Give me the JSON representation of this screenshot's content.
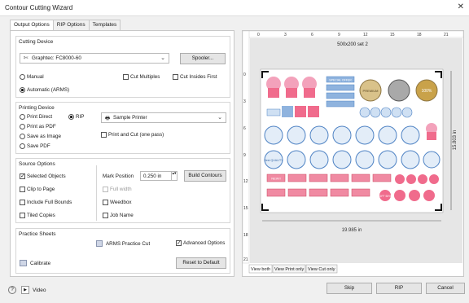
{
  "window": {
    "title": "Contour Cutting Wizard",
    "close": "✕"
  },
  "tabs": [
    "Output Options",
    "RIP Options",
    "Templates"
  ],
  "cutting_device": {
    "legend": "Cutting Device",
    "device": "Graphtec: FC8000-60",
    "spooler": "Spooler...",
    "manual": "Manual",
    "cut_multiples": "Cut Multiples",
    "cut_inside_first": "Cut Insides First",
    "automatic": "Automatic (ARMS)"
  },
  "printing_device": {
    "legend": "Printing Device",
    "print_direct": "Print Direct",
    "rip": "RIP",
    "print_pdf": "Print as PDF",
    "save_image": "Save as Image",
    "save_pdf": "Save PDF",
    "printer": "Sample Printer",
    "print_cut": "Print and Cut (one pass)"
  },
  "source_options": {
    "legend": "Source Options",
    "selected_objects": "Selected Objects",
    "clip_to_page": "Clip to Page",
    "include_full_bounds": "Include Full Bounds",
    "tiled_copies": "Tiled Copies",
    "mark_position": "Mark Position",
    "mark_value": "0.250 in",
    "build_contours": "Build Contours",
    "full_width": "Full width",
    "weedbox": "Weedbox",
    "job_name": "Job Name"
  },
  "practice": {
    "legend": "Practice Sheets",
    "arms_cut": "ARMS Practice Cut",
    "advanced": "Advanced Options",
    "calibrate": "Calibrate",
    "reset": "Reset to Default"
  },
  "preview": {
    "title": "500x200 set 2",
    "ruler_top": [
      "0",
      "3",
      "6",
      "9",
      "12",
      "15",
      "18",
      "21"
    ],
    "ruler_left": [
      "0",
      "3",
      "6",
      "9",
      "12",
      "15",
      "18",
      "21"
    ],
    "width_label": "19.985 in",
    "height_label": "15.803 in",
    "view_tabs": [
      "View both",
      "View Print only",
      "View Cut only"
    ],
    "badge_text": [
      "NEW!!",
      "Best QUALITY",
      "SPECIAL OFFER",
      "100%",
      "OFF 50%",
      "PREMIUM"
    ]
  },
  "footer": {
    "help": "?",
    "video": "Video",
    "skip": "Skip",
    "rip": "RIP",
    "cancel": "Cancel"
  },
  "colors": {
    "accent": "#1e6fd9",
    "pink": "#f06b8c",
    "blue": "#4f83c4",
    "gold": "#c8a24a"
  }
}
